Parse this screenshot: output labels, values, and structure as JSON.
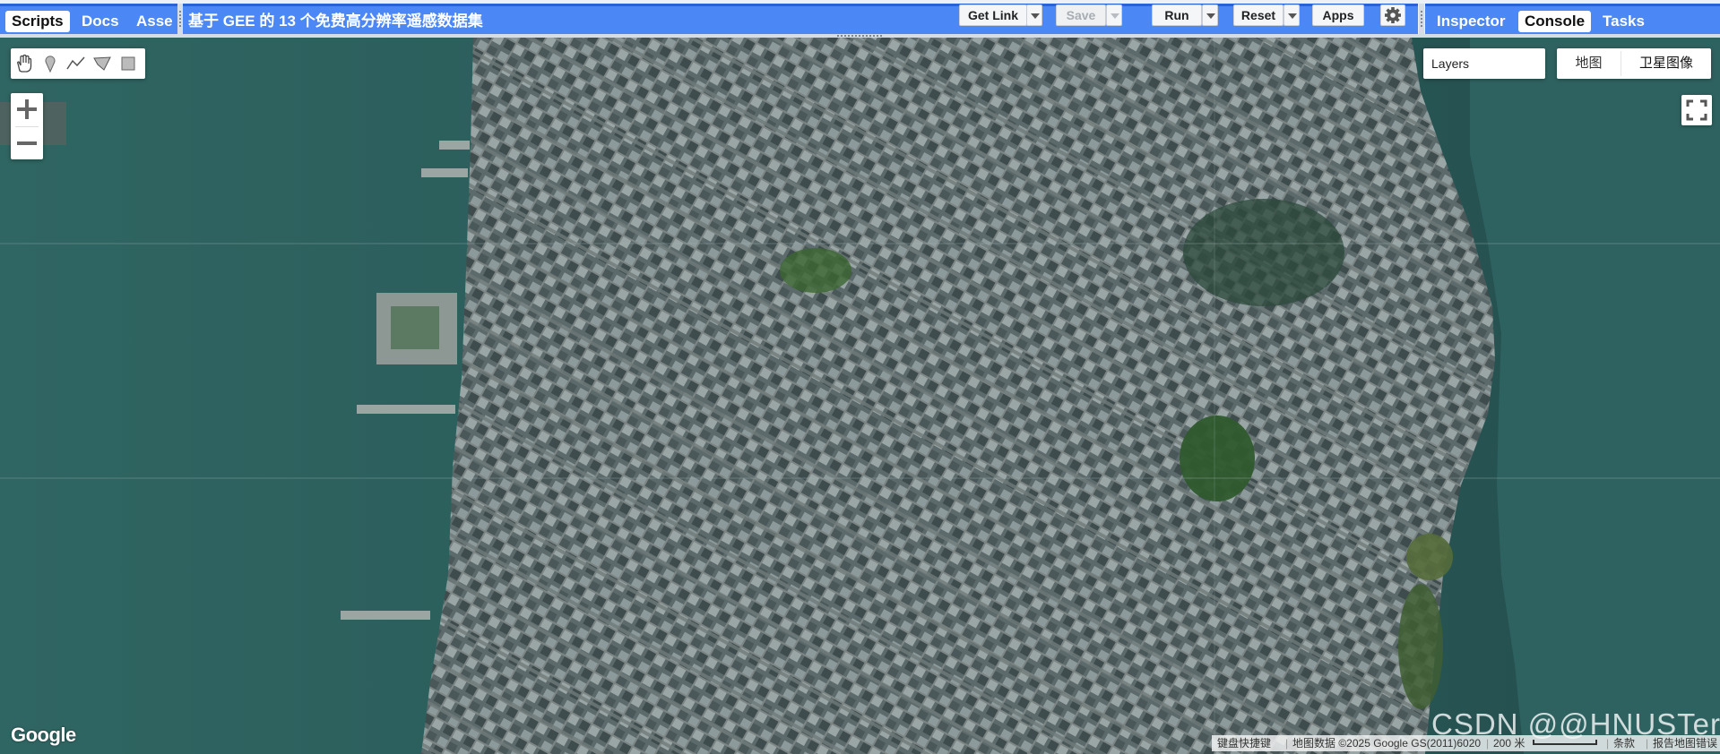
{
  "left_panel": {
    "tabs": [
      {
        "label": "Scripts",
        "active": true
      },
      {
        "label": "Docs",
        "active": false
      },
      {
        "label": "Asse",
        "active": false
      }
    ]
  },
  "editor": {
    "script_title": "基于 GEE 的 13 个免费高分辨率遥感数据集",
    "buttons": {
      "get_link": "Get Link",
      "save": "Save",
      "run": "Run",
      "reset": "Reset",
      "apps": "Apps"
    },
    "settings_icon": "gear-icon"
  },
  "right_panel": {
    "tabs": [
      {
        "label": "Inspector",
        "active": false
      },
      {
        "label": "Console",
        "active": true
      },
      {
        "label": "Tasks",
        "active": false
      }
    ]
  },
  "map": {
    "drawing_tools": [
      "hand-pan-icon",
      "marker-point-icon",
      "polyline-icon",
      "polygon-icon",
      "rectangle-icon"
    ],
    "zoom": {
      "in": "+",
      "out": "−"
    },
    "layers_label": "Layers",
    "map_types": [
      {
        "label": "地图",
        "selected": false
      },
      {
        "label": "卫星图像",
        "selected": true
      }
    ],
    "fullscreen_icon": "fullscreen-icon",
    "logo": "Google",
    "watermark": "CSDN @@HNUSTer",
    "attribution": {
      "shortcuts": "键盘快捷键",
      "map_data": "地图数据 ©2025 Google GS(2011)6020",
      "scale": "200 米",
      "terms": "条款",
      "report": "报告地图错误"
    }
  },
  "colors": {
    "panel_blue": "#4b87f5",
    "water": "#2c5a5e",
    "city": "#6a7a7e"
  }
}
